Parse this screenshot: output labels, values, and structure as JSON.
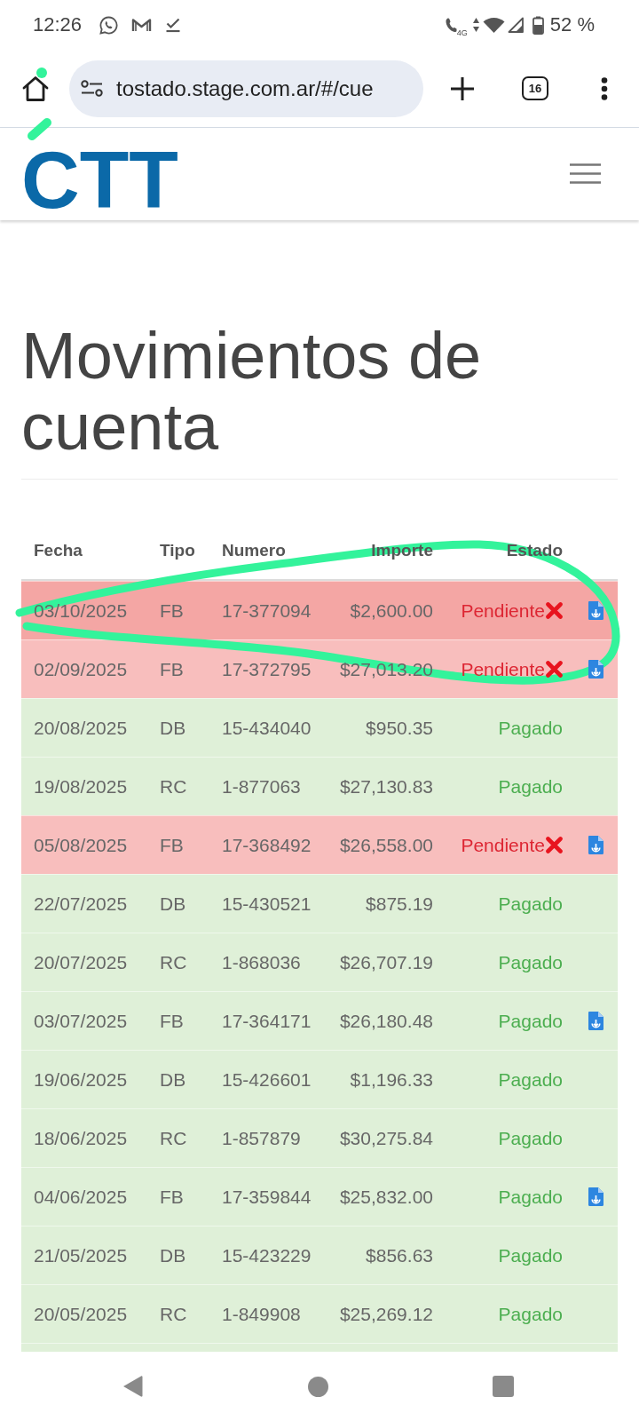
{
  "status_bar": {
    "time": "12:26",
    "network": "4G",
    "battery": "52 %"
  },
  "browser": {
    "url": "tostado.stage.com.ar/#/cue",
    "tab_count": "16"
  },
  "site_header": {
    "logo": "CTT"
  },
  "page": {
    "title": "Movimientos de cuenta"
  },
  "table": {
    "columns": [
      "Fecha",
      "Tipo",
      "Numero",
      "Importe",
      "Estado"
    ],
    "rows": [
      {
        "date": "03/10/2025",
        "type": "FB",
        "number": "17-377094",
        "amount": "$2,600.00",
        "status": "Pendiente",
        "kind": "pending",
        "download": true,
        "selected": true
      },
      {
        "date": "02/09/2025",
        "type": "FB",
        "number": "17-372795",
        "amount": "$27,013.20",
        "status": "Pendiente",
        "kind": "pending",
        "download": true,
        "selected": false
      },
      {
        "date": "20/08/2025",
        "type": "DB",
        "number": "15-434040",
        "amount": "$950.35",
        "status": "Pagado",
        "kind": "paid",
        "download": false,
        "selected": false
      },
      {
        "date": "19/08/2025",
        "type": "RC",
        "number": "1-877063",
        "amount": "$27,130.83",
        "status": "Pagado",
        "kind": "paid",
        "download": false,
        "selected": false
      },
      {
        "date": "05/08/2025",
        "type": "FB",
        "number": "17-368492",
        "amount": "$26,558.00",
        "status": "Pendiente",
        "kind": "pending",
        "download": true,
        "selected": false
      },
      {
        "date": "22/07/2025",
        "type": "DB",
        "number": "15-430521",
        "amount": "$875.19",
        "status": "Pagado",
        "kind": "paid",
        "download": false,
        "selected": false
      },
      {
        "date": "20/07/2025",
        "type": "RC",
        "number": "1-868036",
        "amount": "$26,707.19",
        "status": "Pagado",
        "kind": "paid",
        "download": false,
        "selected": false
      },
      {
        "date": "03/07/2025",
        "type": "FB",
        "number": "17-364171",
        "amount": "$26,180.48",
        "status": "Pagado",
        "kind": "paid",
        "download": true,
        "selected": false
      },
      {
        "date": "19/06/2025",
        "type": "DB",
        "number": "15-426601",
        "amount": "$1,196.33",
        "status": "Pagado",
        "kind": "paid",
        "download": false,
        "selected": false
      },
      {
        "date": "18/06/2025",
        "type": "RC",
        "number": "1-857879",
        "amount": "$30,275.84",
        "status": "Pagado",
        "kind": "paid",
        "download": false,
        "selected": false
      },
      {
        "date": "04/06/2025",
        "type": "FB",
        "number": "17-359844",
        "amount": "$25,832.00",
        "status": "Pagado",
        "kind": "paid",
        "download": true,
        "selected": false
      },
      {
        "date": "21/05/2025",
        "type": "DB",
        "number": "15-423229",
        "amount": "$856.63",
        "status": "Pagado",
        "kind": "paid",
        "download": false,
        "selected": false
      },
      {
        "date": "20/05/2025",
        "type": "RC",
        "number": "1-849908",
        "amount": "$25,269.12",
        "status": "Pagado",
        "kind": "paid",
        "download": false,
        "selected": false
      }
    ]
  }
}
